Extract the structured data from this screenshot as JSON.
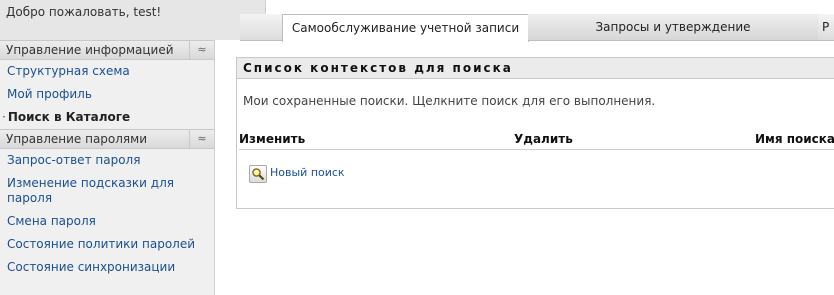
{
  "header": {
    "welcome": "Добро пожаловать, test!",
    "tabs": [
      {
        "label": "Самообслуживание учетной записи",
        "active": true
      },
      {
        "label": "Запросы и утверждение",
        "active": false
      },
      {
        "label": "Р",
        "active": false
      }
    ]
  },
  "sidebar": {
    "sections": [
      {
        "title": "Управление информацией",
        "items": [
          "Структурная схема",
          "Мой профиль",
          "Поиск в Каталоге"
        ]
      },
      {
        "title": "Управление паролями",
        "items": [
          "Запрос-ответ пароля",
          "Изменение подсказки для пароля",
          "Смена пароля",
          "Состояние политики паролей",
          "Состояние синхронизации"
        ]
      }
    ],
    "current_item": "Поиск в Каталоге",
    "collapse_glyph": "≈"
  },
  "main": {
    "panel_title": "Список контекстов для поиска",
    "description": "Мои сохраненные поиски. Щелкните поиск для его выполнения.",
    "columns": [
      "Изменить",
      "Удалить",
      "Имя поиска"
    ],
    "new_search": {
      "label": "Новый поиск",
      "icon": "search-icon"
    }
  },
  "colors": {
    "link": "#1a4f8f",
    "section_bg": "#e3e3e3",
    "panel_title_bg": "#ebebeb"
  }
}
